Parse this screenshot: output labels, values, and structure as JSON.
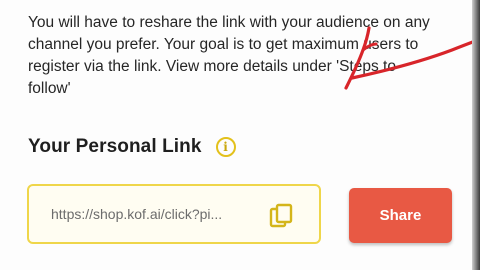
{
  "description": {
    "line1": "You will have to reshare the link with your audience on any",
    "line2": "channel you prefer. Your goal is to get maximum users to",
    "line3": "register via the link. View more details under 'Steps to",
    "line4": "follow'"
  },
  "personal_link": {
    "title": "Your Personal Link",
    "info_icon_glyph": "i",
    "link_value": "https://shop.kof.ai/click?pi...",
    "share_label": "Share"
  },
  "colors": {
    "accent_yellow": "#efd64a",
    "share_button": "#e85944",
    "annotation_red": "#d8252a"
  },
  "icons": {
    "info": "info-icon",
    "copy": "copy-icon"
  }
}
